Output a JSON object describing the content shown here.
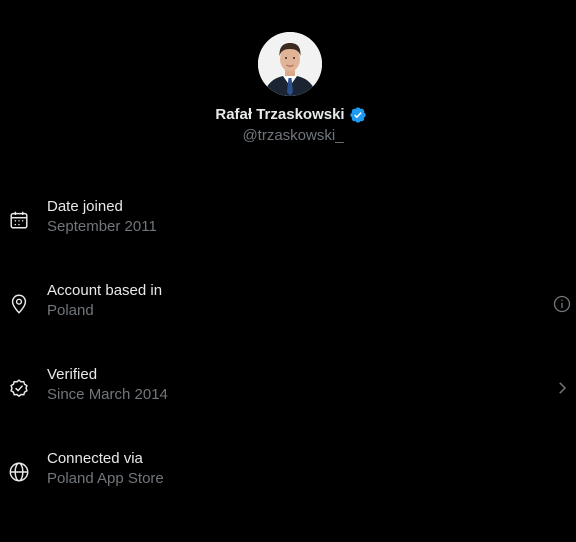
{
  "profile": {
    "display_name": "Rafał Trzaskowski",
    "handle": "@trzaskowski_",
    "verified": true,
    "avatar_icon": "profile-photo",
    "badge_color": "#1d9bf0"
  },
  "rows": [
    {
      "icon": "calendar-icon",
      "title": "Date joined",
      "subtitle": "September 2011",
      "action": null
    },
    {
      "icon": "location-pin-icon",
      "title": "Account based in",
      "subtitle": "Poland",
      "action": "info-icon"
    },
    {
      "icon": "verified-check-icon",
      "title": "Verified",
      "subtitle": "Since March 2014",
      "action": "chevron-right-icon"
    },
    {
      "icon": "globe-icon",
      "title": "Connected via",
      "subtitle": "Poland App Store",
      "action": null
    }
  ],
  "colors": {
    "background": "#000000",
    "primary_text": "#e7e9ea",
    "secondary_text": "#71767b",
    "accent": "#1d9bf0"
  }
}
